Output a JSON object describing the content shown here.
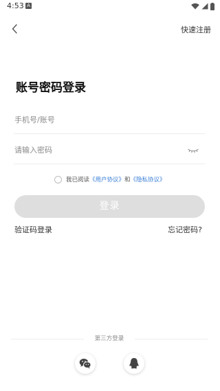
{
  "status_bar": {
    "time": "4:53",
    "notification_icon": "A"
  },
  "nav": {
    "back_icon": "chevron-left-icon",
    "register_label": "快速注册"
  },
  "title": "账号密码登录",
  "form": {
    "phone_placeholder": "手机号/账号",
    "phone_value": "",
    "password_placeholder": "请输入密码",
    "password_value": "",
    "eye_icon": "eye-closed-icon"
  },
  "agreement": {
    "prefix": "我已阅读",
    "user_agreement": "《用户协议》",
    "conjunction": "和",
    "privacy_policy": "《隐私协议》",
    "checked": false
  },
  "login_button_label": "登录",
  "links": {
    "sms_login": "验证码登录",
    "forgot_password": "忘记密码?"
  },
  "third_party": {
    "label": "第三方登录",
    "providers": [
      "wechat-icon",
      "qq-icon"
    ]
  },
  "colors": {
    "link_blue": "#3b7fd8",
    "button_disabled": "#dedede",
    "text_dark": "#111111"
  }
}
